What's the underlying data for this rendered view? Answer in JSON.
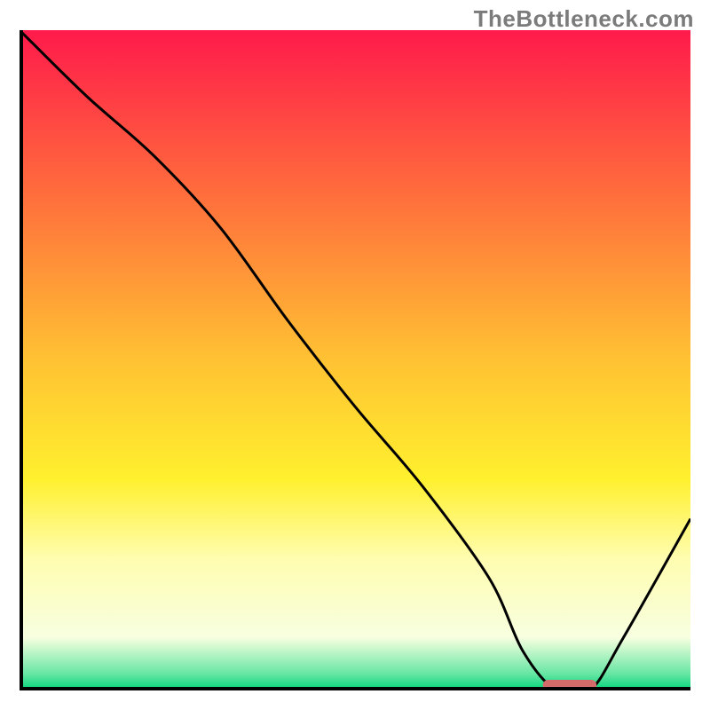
{
  "watermark": "TheBottleneck.com",
  "chart_data": {
    "type": "line",
    "title": "",
    "xlabel": "",
    "ylabel": "",
    "xlim": [
      0,
      100
    ],
    "ylim": [
      0,
      100
    ],
    "grid": false,
    "legend": false,
    "gradient_stops": [
      {
        "offset": 0.0,
        "color": "#ff1a4b"
      },
      {
        "offset": 0.25,
        "color": "#ff6e3c"
      },
      {
        "offset": 0.5,
        "color": "#ffc233"
      },
      {
        "offset": 0.68,
        "color": "#fff02e"
      },
      {
        "offset": 0.8,
        "color": "#fffdb0"
      },
      {
        "offset": 0.92,
        "color": "#f7ffe0"
      },
      {
        "offset": 0.975,
        "color": "#66e6a3"
      },
      {
        "offset": 1.0,
        "color": "#00d27a"
      }
    ],
    "series": [
      {
        "name": "bottleneck-curve",
        "x": [
          0,
          10,
          20,
          30,
          40,
          50,
          60,
          70,
          75,
          80,
          85,
          90,
          100
        ],
        "y": [
          100,
          90,
          81,
          70,
          56,
          43,
          31,
          17,
          6,
          0,
          0,
          8,
          26
        ]
      }
    ],
    "marker": {
      "name": "optimal-range",
      "x_start": 78,
      "x_end": 86,
      "y": 0,
      "color": "#d46a6a"
    }
  }
}
